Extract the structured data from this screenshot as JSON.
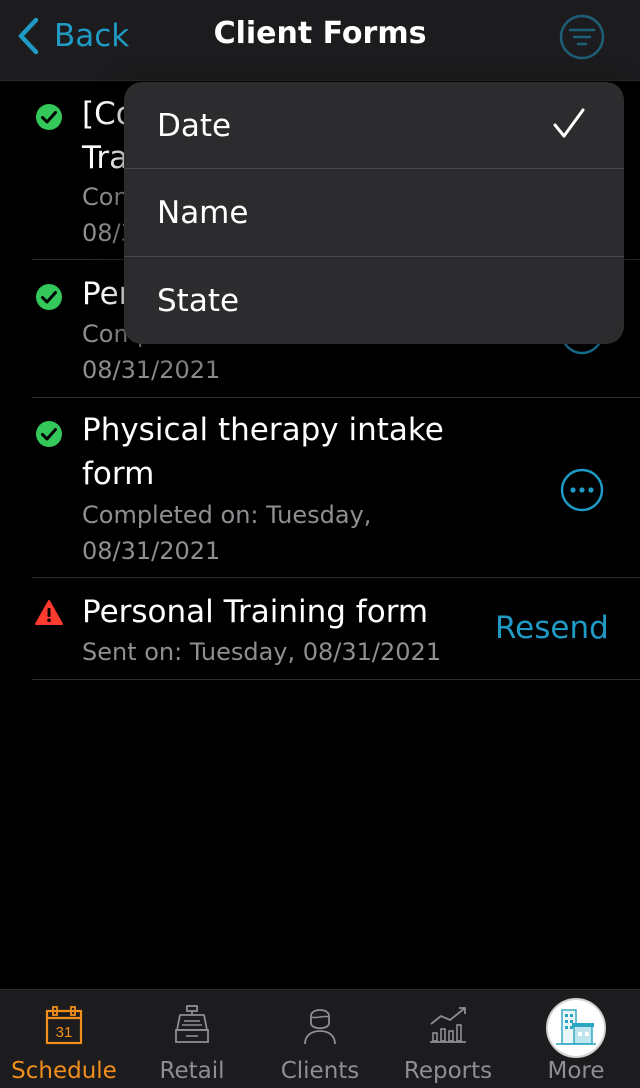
{
  "header": {
    "back_label": "Back",
    "title": "Client Forms",
    "filter_icon": "filter-lines-icon"
  },
  "forms": [
    {
      "title_lines": [
        "[Co",
        "Tra"
      ],
      "meta_lines": [
        "Con",
        "08/3"
      ],
      "status": "completed",
      "action": "more"
    },
    {
      "title_lines": [
        "Per"
      ],
      "meta_lines": [
        "Comp",
        "08/31/2021"
      ],
      "status": "completed",
      "action": "more"
    },
    {
      "title_lines": [
        "Physical therapy intake",
        "form"
      ],
      "meta_lines": [
        "Completed on: Tuesday,",
        "08/31/2021"
      ],
      "status": "completed",
      "action": "more"
    },
    {
      "title_lines": [
        "Personal Training form"
      ],
      "meta_lines": [
        "Sent on: Tuesday, 08/31/2021"
      ],
      "status": "warning",
      "action": "Resend"
    }
  ],
  "sort_menu": {
    "items": [
      {
        "label": "Date",
        "selected": true
      },
      {
        "label": "Name",
        "selected": false
      },
      {
        "label": "State",
        "selected": false
      }
    ]
  },
  "tabbar": {
    "tabs": [
      {
        "label": "Schedule",
        "icon": "calendar-icon",
        "calendar_day": "31",
        "active": true
      },
      {
        "label": "Retail",
        "icon": "cash-register-icon",
        "active": false
      },
      {
        "label": "Clients",
        "icon": "person-icon",
        "active": false
      },
      {
        "label": "Reports",
        "icon": "bar-chart-icon",
        "active": false
      },
      {
        "label": "More",
        "icon": "building-avatar-icon",
        "active": false
      }
    ]
  },
  "colors": {
    "accent": "#1e9ac4",
    "active_tab": "#f28e1c",
    "success": "#34c759",
    "warning": "#ff3b30",
    "secondary_text": "#8e8e93"
  }
}
